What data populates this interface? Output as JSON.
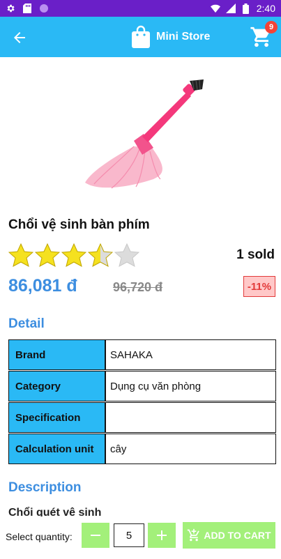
{
  "status_bar": {
    "time": "2:40",
    "icons": [
      "gear-icon",
      "sd-card-icon",
      "circle-icon",
      "wifi-icon",
      "signal-icon",
      "battery-icon"
    ]
  },
  "app_bar": {
    "title": "Mini Store",
    "cart_count": "9",
    "background": "#2ab9f5"
  },
  "product": {
    "name": "Chổi vệ sinh bàn phím",
    "rating": 3.5,
    "rating_max": 5,
    "sold_text": "1 sold",
    "price": "86,081 đ",
    "old_price": "96,720 đ",
    "discount": "-11%"
  },
  "detail": {
    "title": "Detail",
    "rows": [
      {
        "key": "Brand",
        "value": "SAHAKA"
      },
      {
        "key": "Category",
        "value": "Dụng cụ văn phòng"
      },
      {
        "key": "Specification",
        "value": ""
      },
      {
        "key": "Calculation unit",
        "value": "cây"
      }
    ]
  },
  "description": {
    "title": "Description",
    "peek_text": "Chổi quét vệ sinh"
  },
  "bottom_bar": {
    "quantity_label": "Select quantity:",
    "quantity_value": "5",
    "add_to_cart_label": "ADD TO CART",
    "accent": "#a3f07a"
  }
}
